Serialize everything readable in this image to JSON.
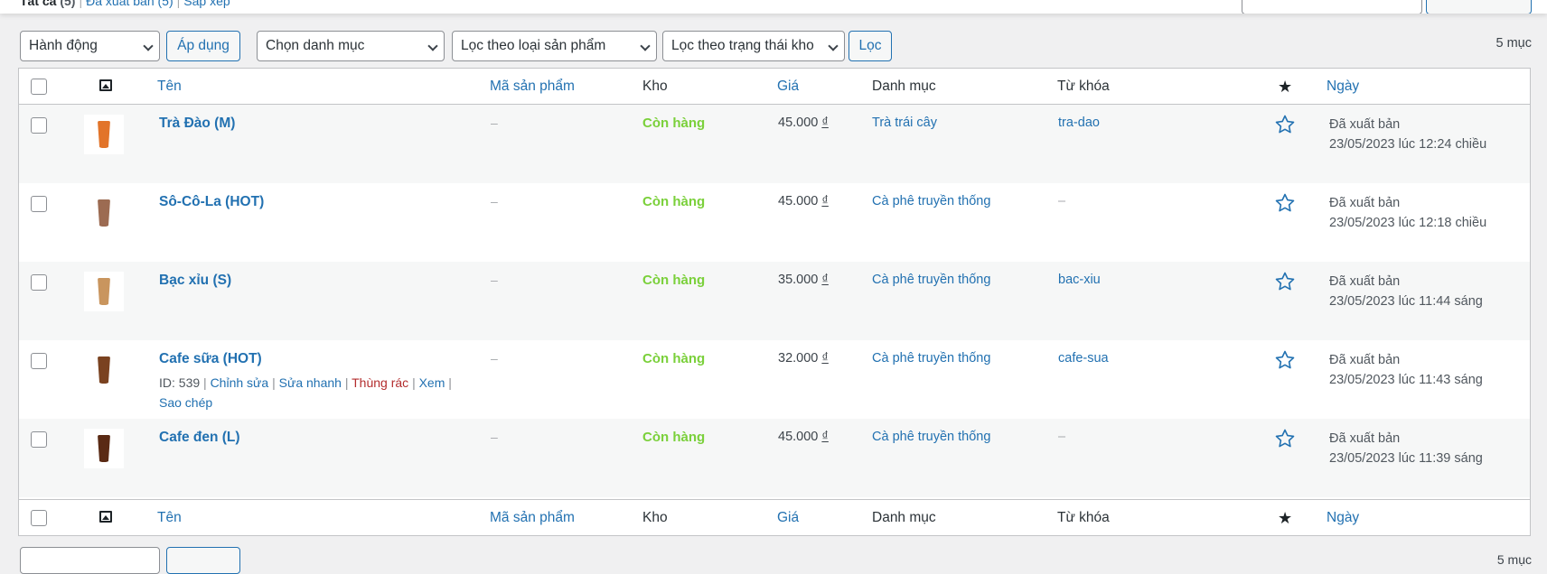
{
  "subsubsub": {
    "all_label": "Tất cả",
    "all_count": "(5)",
    "published_label": "Đã xuất bản",
    "published_count": "(5)",
    "sort_label": "Sắp xếp"
  },
  "filters": {
    "bulk_action": "Hành động",
    "apply_label": "Áp dụng",
    "category_select": "Chọn danh mục",
    "type_select": "Lọc theo loại sản phẩm",
    "stock_select": "Lọc theo trạng thái kho",
    "filter_label": "Lọc",
    "items_count": "5 mục"
  },
  "columns": {
    "name": "Tên",
    "sku": "Mã sản phẩm",
    "stock": "Kho",
    "price": "Giá",
    "categories": "Danh mục",
    "tags": "Từ khóa",
    "featured": "★",
    "date": "Ngày"
  },
  "products": [
    {
      "name": "Trà Đào (M)",
      "sku": "–",
      "stock": "Còn hàng",
      "price": "45.000",
      "currency": "₫",
      "category": "Trà trái cây",
      "tag": "tra-dao",
      "status": "Đã xuất bản",
      "date": "23/05/2023 lúc 12:24 chiều",
      "cup_color": "#e2742a"
    },
    {
      "name": "Sô-Cô-La (HOT)",
      "sku": "–",
      "stock": "Còn hàng",
      "price": "45.000",
      "currency": "₫",
      "category": "Cà phê truyền thống",
      "tag": "–",
      "status": "Đã xuất bản",
      "date": "23/05/2023 lúc 12:18 chiều",
      "cup_color": "#9c6b52"
    },
    {
      "name": "Bạc xỉu (S)",
      "sku": "–",
      "stock": "Còn hàng",
      "price": "35.000",
      "currency": "₫",
      "category": "Cà phê truyền thống",
      "tag": "bac-xiu",
      "status": "Đã xuất bản",
      "date": "23/05/2023 lúc 11:44 sáng",
      "cup_color": "#c9955e"
    },
    {
      "name": "Cafe sữa (HOT)",
      "sku": "–",
      "stock": "Còn hàng",
      "price": "32.000",
      "currency": "₫",
      "category": "Cà phê truyền thống",
      "tag": "cafe-sua",
      "status": "Đã xuất bản",
      "date": "23/05/2023 lúc 11:43 sáng",
      "cup_color": "#7a4220",
      "row_actions": {
        "id": "ID: 539",
        "edit": "Chỉnh sửa",
        "quick_edit": "Sửa nhanh",
        "trash": "Thùng rác",
        "view": "Xem",
        "duplicate": "Sao chép"
      }
    },
    {
      "name": "Cafe đen (L)",
      "sku": "–",
      "stock": "Còn hàng",
      "price": "45.000",
      "currency": "₫",
      "category": "Cà phê truyền thống",
      "tag": "–",
      "status": "Đã xuất bản",
      "date": "23/05/2023 lúc 11:39 sáng",
      "cup_color": "#5a2a14"
    }
  ],
  "bottom": {
    "items_count": "5 mục"
  },
  "colors": {
    "link": "#2271b1",
    "in_stock": "#7ad03a",
    "trash": "#b32d2e"
  }
}
